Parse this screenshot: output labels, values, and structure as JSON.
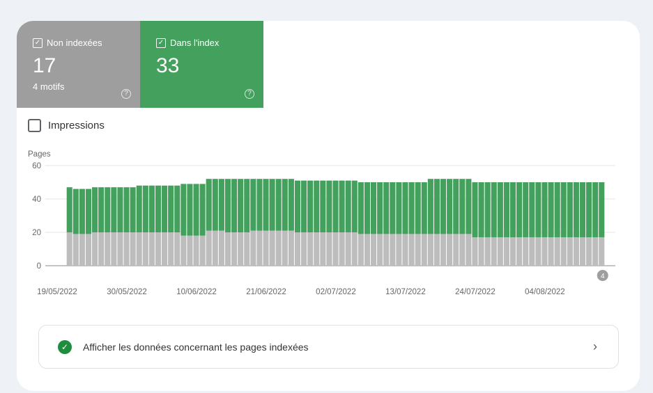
{
  "tiles": [
    {
      "label": "Non indexées",
      "value": "17",
      "sub": "4 motifs",
      "help": "?",
      "color": "#9e9e9e"
    },
    {
      "label": "Dans l'index",
      "value": "33",
      "help": "?",
      "color": "#43a05d"
    }
  ],
  "impressions_label": "Impressions",
  "chart_data": {
    "type": "bar",
    "stacked": true,
    "ylabel": "Pages",
    "ylim": [
      0,
      60
    ],
    "yticks": [
      "0",
      "20",
      "40",
      "60"
    ],
    "xticks": [
      "19/05/2022",
      "30/05/2022",
      "10/06/2022",
      "21/06/2022",
      "02/07/2022",
      "13/07/2022",
      "24/07/2022",
      "04/08/2022"
    ],
    "x_start": "21/05/2022",
    "x_step_days": 1,
    "annotation": "4",
    "series": [
      {
        "name": "Non indexées",
        "color": "#bdbdbd",
        "values": [
          20,
          19,
          19,
          19,
          20,
          20,
          20,
          20,
          20,
          20,
          20,
          20,
          20,
          20,
          20,
          20,
          20,
          20,
          18,
          18,
          18,
          18,
          21,
          21,
          21,
          20,
          20,
          20,
          20,
          21,
          21,
          21,
          21,
          21,
          21,
          21,
          20,
          20,
          20,
          20,
          20,
          20,
          20,
          20,
          20,
          20,
          19,
          19,
          19,
          19,
          19,
          19,
          19,
          19,
          19,
          19,
          19,
          19,
          19,
          19,
          19,
          19,
          19,
          19,
          17,
          17,
          17,
          17,
          17,
          17,
          17,
          17,
          17,
          17,
          17,
          17,
          17,
          17,
          17,
          17,
          17,
          17,
          17,
          17,
          17
        ]
      },
      {
        "name": "Dans l'index",
        "color": "#43a05d",
        "values": [
          27,
          27,
          27,
          27,
          27,
          27,
          27,
          27,
          27,
          27,
          27,
          28,
          28,
          28,
          28,
          28,
          28,
          28,
          31,
          31,
          31,
          31,
          31,
          31,
          31,
          32,
          32,
          32,
          32,
          31,
          31,
          31,
          31,
          31,
          31,
          31,
          31,
          31,
          31,
          31,
          31,
          31,
          31,
          31,
          31,
          31,
          31,
          31,
          31,
          31,
          31,
          31,
          31,
          31,
          31,
          31,
          31,
          33,
          33,
          33,
          33,
          33,
          33,
          33,
          33,
          33,
          33,
          33,
          33,
          33,
          33,
          33,
          33,
          33,
          33,
          33,
          33,
          33,
          33,
          33,
          33,
          33,
          33,
          33,
          33
        ]
      }
    ]
  },
  "bottom": {
    "label": "Afficher les données concernant les pages indexées"
  }
}
